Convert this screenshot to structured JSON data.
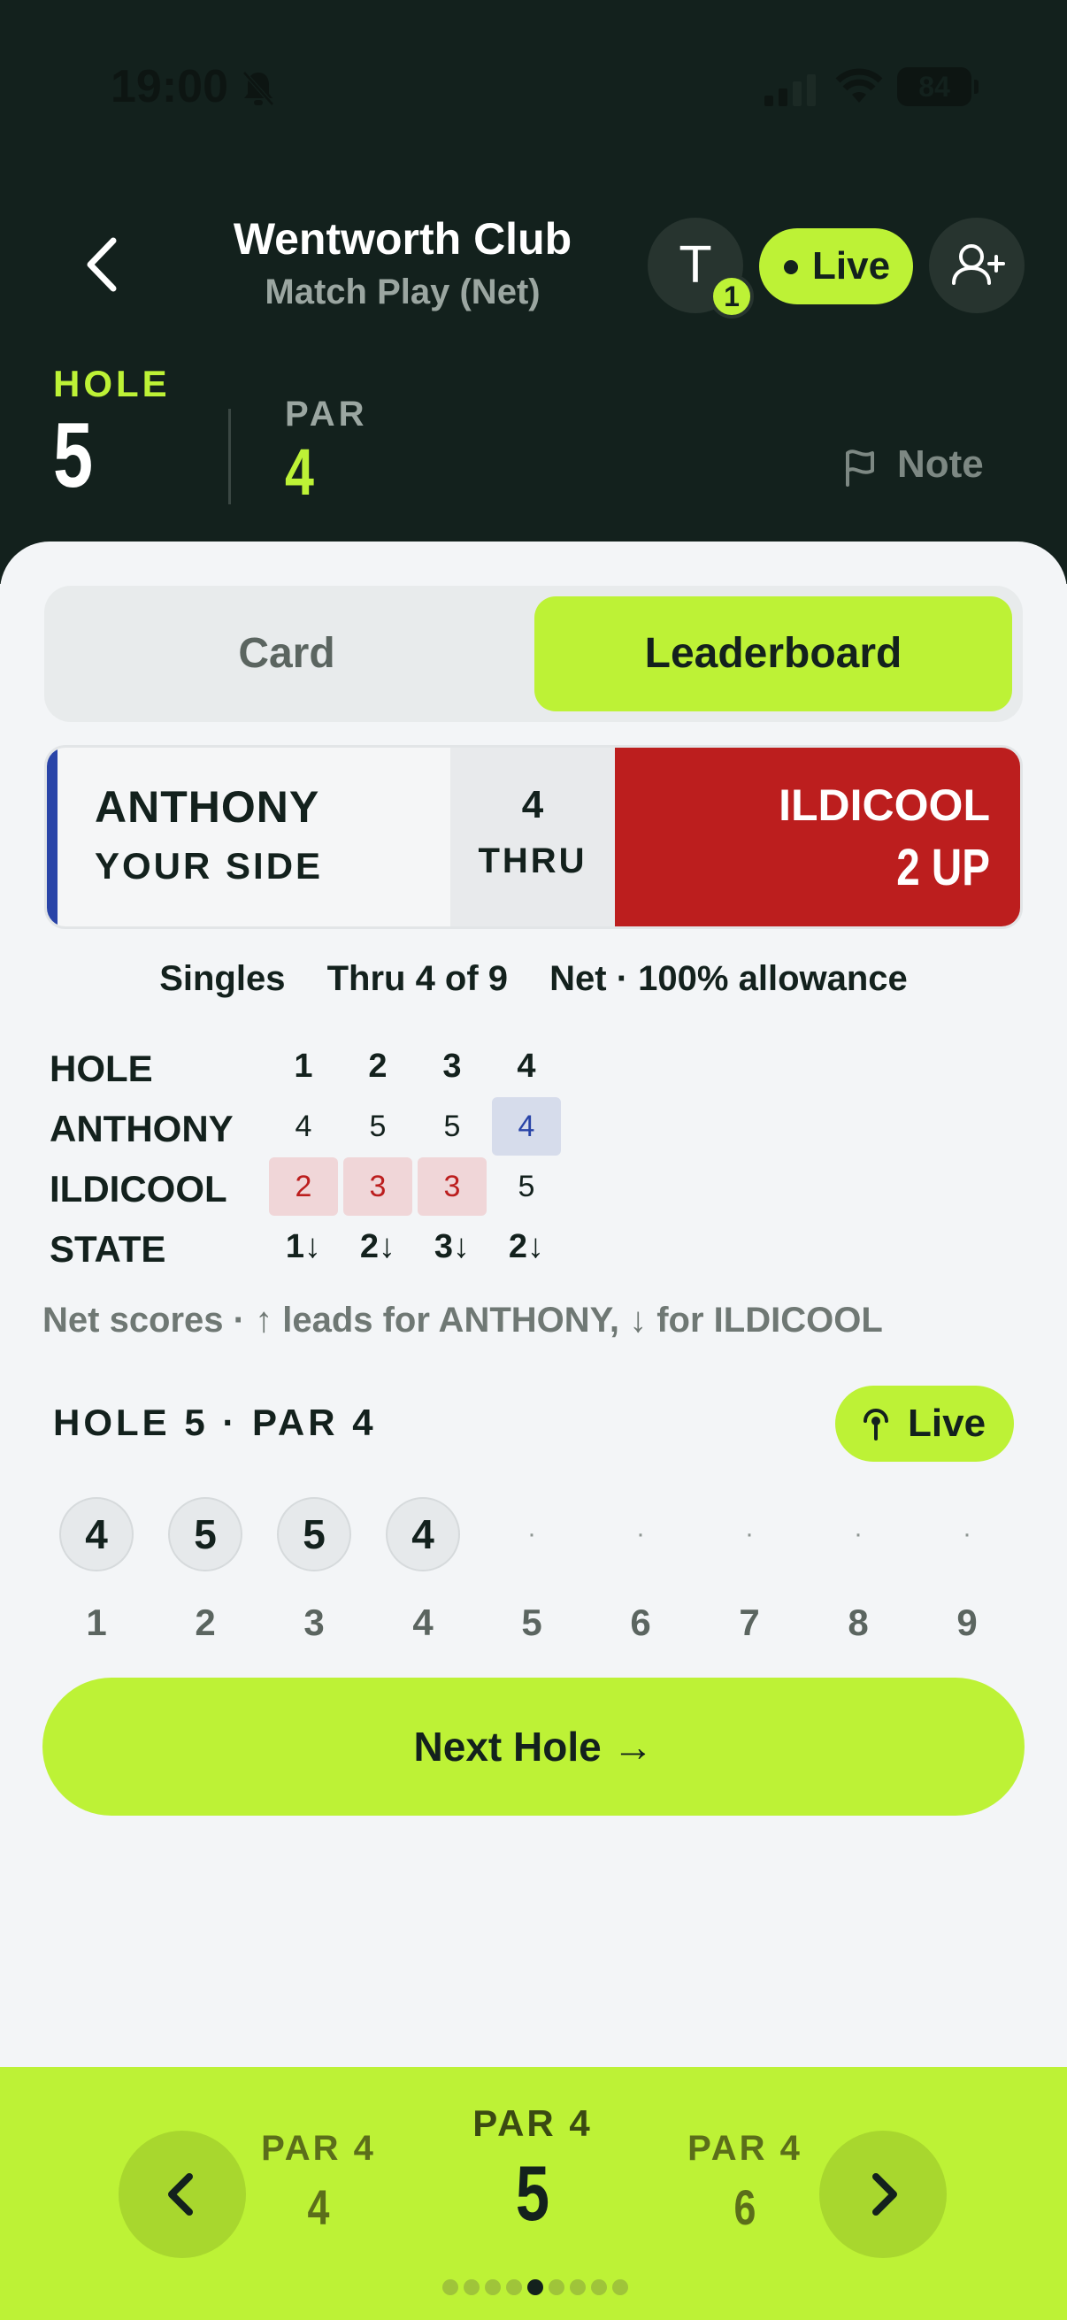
{
  "status_bar": {
    "time": "19:00",
    "battery": "84"
  },
  "header": {
    "club_name": "Wentworth Club",
    "match_type": "Match Play (Net)",
    "text_badge_count": "1",
    "live_label": "Live",
    "hole_label": "HOLE",
    "hole_number": "5",
    "par_label": "PAR",
    "par_value": "4",
    "note_label": "Note"
  },
  "tabs": {
    "card": "Card",
    "leaderboard": "Leaderboard",
    "selected": "Leaderboard"
  },
  "match_card": {
    "player_name": "ANTHONY",
    "player_side": "YOUR SIDE",
    "thru_number": "4",
    "thru_label": "THRU",
    "opponent_name": "ILDICOOL",
    "status": "2 UP",
    "colors": {
      "player": "#2944a8",
      "opponent": "#bc1e1e"
    }
  },
  "info": {
    "format": "Singles",
    "progress": "Thru 4 of 9",
    "allowance": "Net · 100% allowance"
  },
  "score_grid": {
    "row_labels": [
      "HOLE",
      "ANTHONY",
      "ILDICOOL",
      "STATE"
    ],
    "holes": [
      "1",
      "2",
      "3",
      "4"
    ],
    "anthony": [
      "4",
      "5",
      "5",
      "4"
    ],
    "ildicool": [
      "2",
      "3",
      "3",
      "5"
    ],
    "state": [
      "1↓",
      "2↓",
      "3↓",
      "2↓"
    ],
    "anthony_wins": [
      false,
      false,
      false,
      true
    ],
    "ildicool_wins": [
      true,
      true,
      true,
      false
    ]
  },
  "legend_note": "Net scores · ↑ leads for ANTHONY, ↓ for ILDICOOL",
  "hole_section": {
    "title": "HOLE 5 · PAR 4",
    "live_label": "Live"
  },
  "strip": {
    "scores": [
      "4",
      "5",
      "5",
      "4",
      "·",
      "·",
      "·",
      "·",
      "·"
    ],
    "holes": [
      "1",
      "2",
      "3",
      "4",
      "5",
      "6",
      "7",
      "8",
      "9"
    ]
  },
  "next_hole_label": "Next Hole →",
  "bottom_nav": {
    "prev": {
      "par": "PAR 4",
      "hole": "4"
    },
    "current": {
      "par": "PAR 4",
      "hole": "5"
    },
    "next": {
      "par": "PAR 4",
      "hole": "6"
    },
    "page_count": 9,
    "active_page": 5
  },
  "colors": {
    "accent": "#bdf236",
    "header_bg": "#13211d",
    "loss": "#bc1e1e",
    "win": "#2944a8"
  }
}
